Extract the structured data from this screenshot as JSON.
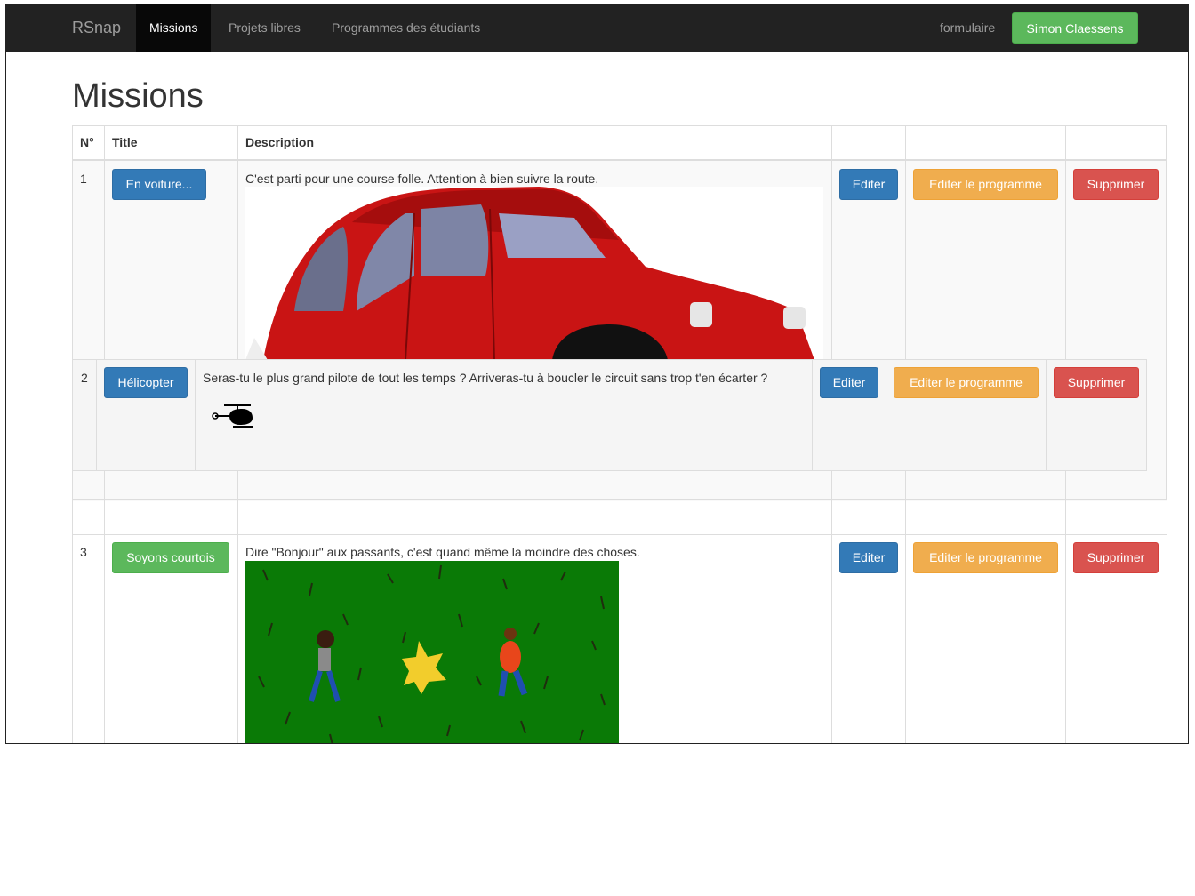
{
  "navbar": {
    "brand": "RSnap",
    "items": [
      {
        "label": "Missions",
        "active": true
      },
      {
        "label": "Projets libres"
      },
      {
        "label": "Programmes des étudiants"
      }
    ],
    "right_link": "formulaire",
    "user_button": "Simon Claessens"
  },
  "page": {
    "title": "Missions"
  },
  "table": {
    "headers": [
      "N°",
      "Title",
      "Description",
      "",
      "",
      ""
    ],
    "rows": [
      {
        "num": "1",
        "title": "En voiture...",
        "title_color": "#337ab7",
        "description": "C'est parti pour une course folle. Attention à bien suivre la route.",
        "image": "red-car-image",
        "edit": "Editer",
        "edit_program": "Editer le programme",
        "delete": "Supprimer"
      },
      {
        "num": "2",
        "title": "Hélicopter",
        "title_color": "#337ab7",
        "description": "Seras-tu le plus grand pilote de tout les temps ? Arriveras-tu à boucler le circuit sans trop t'en écarter ?",
        "image": "helicopter-icon",
        "edit": "Editer",
        "edit_program": "Editer le programme",
        "delete": "Supprimer"
      },
      {
        "num": "3",
        "title": "Soyons courtois",
        "title_color": "#5cb85c",
        "description": "Dire \"Bonjour\" aux passants, c'est quand même la moindre des choses.",
        "image": "grass-scene-image",
        "edit": "Editer",
        "edit_program": "Editer le programme",
        "delete": "Supprimer"
      }
    ]
  },
  "colors": {
    "primary": "#337ab7",
    "warning": "#f0ad4e",
    "danger": "#d9534f",
    "success": "#5cb85c",
    "navbar": "#222222"
  }
}
